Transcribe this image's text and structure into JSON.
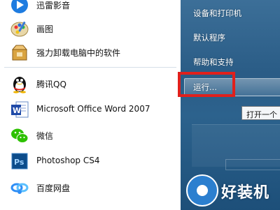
{
  "left_menu": {
    "items": [
      {
        "label": "迅雷影音",
        "icon": "xunlei-player-icon"
      },
      {
        "label": "画图",
        "icon": "paint-icon"
      },
      {
        "label": "强力卸载电脑中的软件",
        "icon": "uninstall-box-icon"
      },
      {
        "label": "腾讯QQ",
        "icon": "qq-penguin-icon"
      },
      {
        "label": "Microsoft Office Word 2007",
        "icon": "word-icon"
      },
      {
        "label": "微信",
        "icon": "wechat-icon"
      },
      {
        "label": "Photoshop CS4",
        "icon": "photoshop-icon"
      },
      {
        "label": "百度网盘",
        "icon": "baidu-netdisk-icon"
      }
    ]
  },
  "right_menu": {
    "items": [
      {
        "label": "设备和打印机"
      },
      {
        "label": "默认程序"
      },
      {
        "label": "帮助和支持"
      },
      {
        "label": "运行..."
      }
    ]
  },
  "tooltip": {
    "text": "打开一个"
  },
  "watermark": {
    "text": "好装机",
    "icon": "eye-logo-icon"
  },
  "colors": {
    "highlight_box": "#e0201c",
    "right_panel": "#2a5c86",
    "watermark_blue": "#2b7fcf"
  }
}
